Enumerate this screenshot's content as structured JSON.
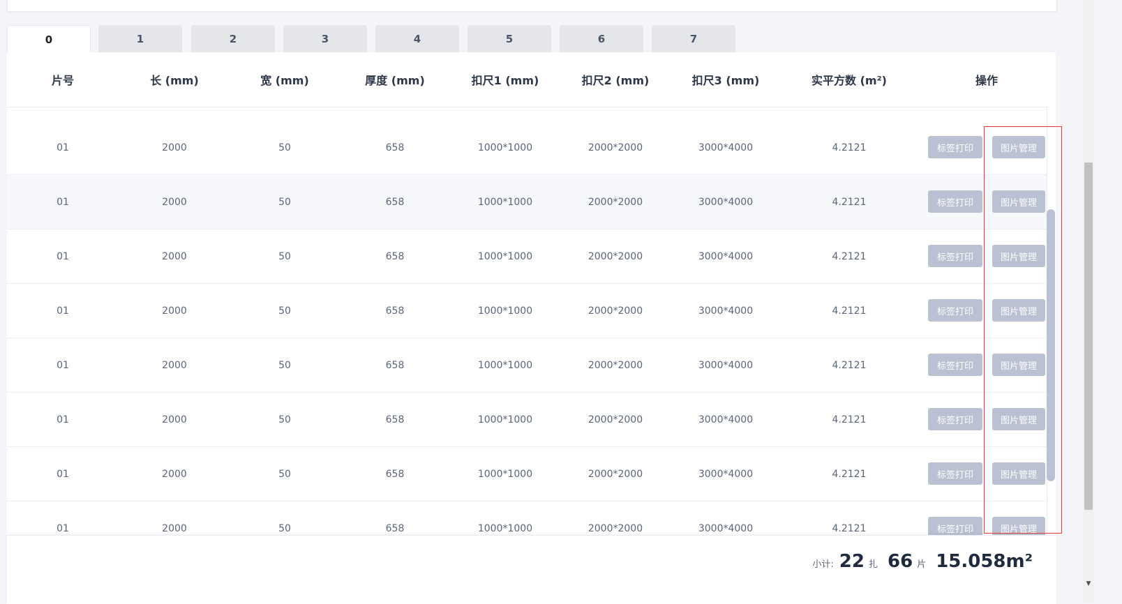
{
  "tabs": [
    "0",
    "1",
    "2",
    "3",
    "4",
    "5",
    "6",
    "7"
  ],
  "active_tab": "0",
  "columns": [
    "片号",
    "长 (mm)",
    "宽 (mm)",
    "厚度 (mm)",
    "扣尺1 (mm)",
    "扣尺2 (mm)",
    "扣尺3 (mm)",
    "实平方数 (m²)",
    "操作"
  ],
  "rows": [
    {
      "no": "01",
      "length": "2000",
      "width": "50",
      "thickness": "658",
      "cut1": "1000*1000",
      "cut2": "2000*2000",
      "cut3": "3000*4000",
      "area": "4.2121"
    },
    {
      "no": "01",
      "length": "2000",
      "width": "50",
      "thickness": "658",
      "cut1": "1000*1000",
      "cut2": "2000*2000",
      "cut3": "3000*4000",
      "area": "4.2121"
    },
    {
      "no": "01",
      "length": "2000",
      "width": "50",
      "thickness": "658",
      "cut1": "1000*1000",
      "cut2": "2000*2000",
      "cut3": "3000*4000",
      "area": "4.2121"
    },
    {
      "no": "01",
      "length": "2000",
      "width": "50",
      "thickness": "658",
      "cut1": "1000*1000",
      "cut2": "2000*2000",
      "cut3": "3000*4000",
      "area": "4.2121"
    },
    {
      "no": "01",
      "length": "2000",
      "width": "50",
      "thickness": "658",
      "cut1": "1000*1000",
      "cut2": "2000*2000",
      "cut3": "3000*4000",
      "area": "4.2121"
    },
    {
      "no": "01",
      "length": "2000",
      "width": "50",
      "thickness": "658",
      "cut1": "1000*1000",
      "cut2": "2000*2000",
      "cut3": "3000*4000",
      "area": "4.2121"
    },
    {
      "no": "01",
      "length": "2000",
      "width": "50",
      "thickness": "658",
      "cut1": "1000*1000",
      "cut2": "2000*2000",
      "cut3": "3000*4000",
      "area": "4.2121"
    },
    {
      "no": "01",
      "length": "2000",
      "width": "50",
      "thickness": "658",
      "cut1": "1000*1000",
      "cut2": "2000*2000",
      "cut3": "3000*4000",
      "area": "4.2121"
    }
  ],
  "actions": {
    "print": "标签打印",
    "picture": "图片管理"
  },
  "summary": {
    "label": "小计:",
    "bundles": "22",
    "bundle_unit": "扎",
    "pieces": "66",
    "piece_unit": "片",
    "area": "15.058m²"
  },
  "colors": {
    "button": "#b9c1d2",
    "highlight": "#e53935",
    "tab_inactive": "#e4e6ea"
  }
}
